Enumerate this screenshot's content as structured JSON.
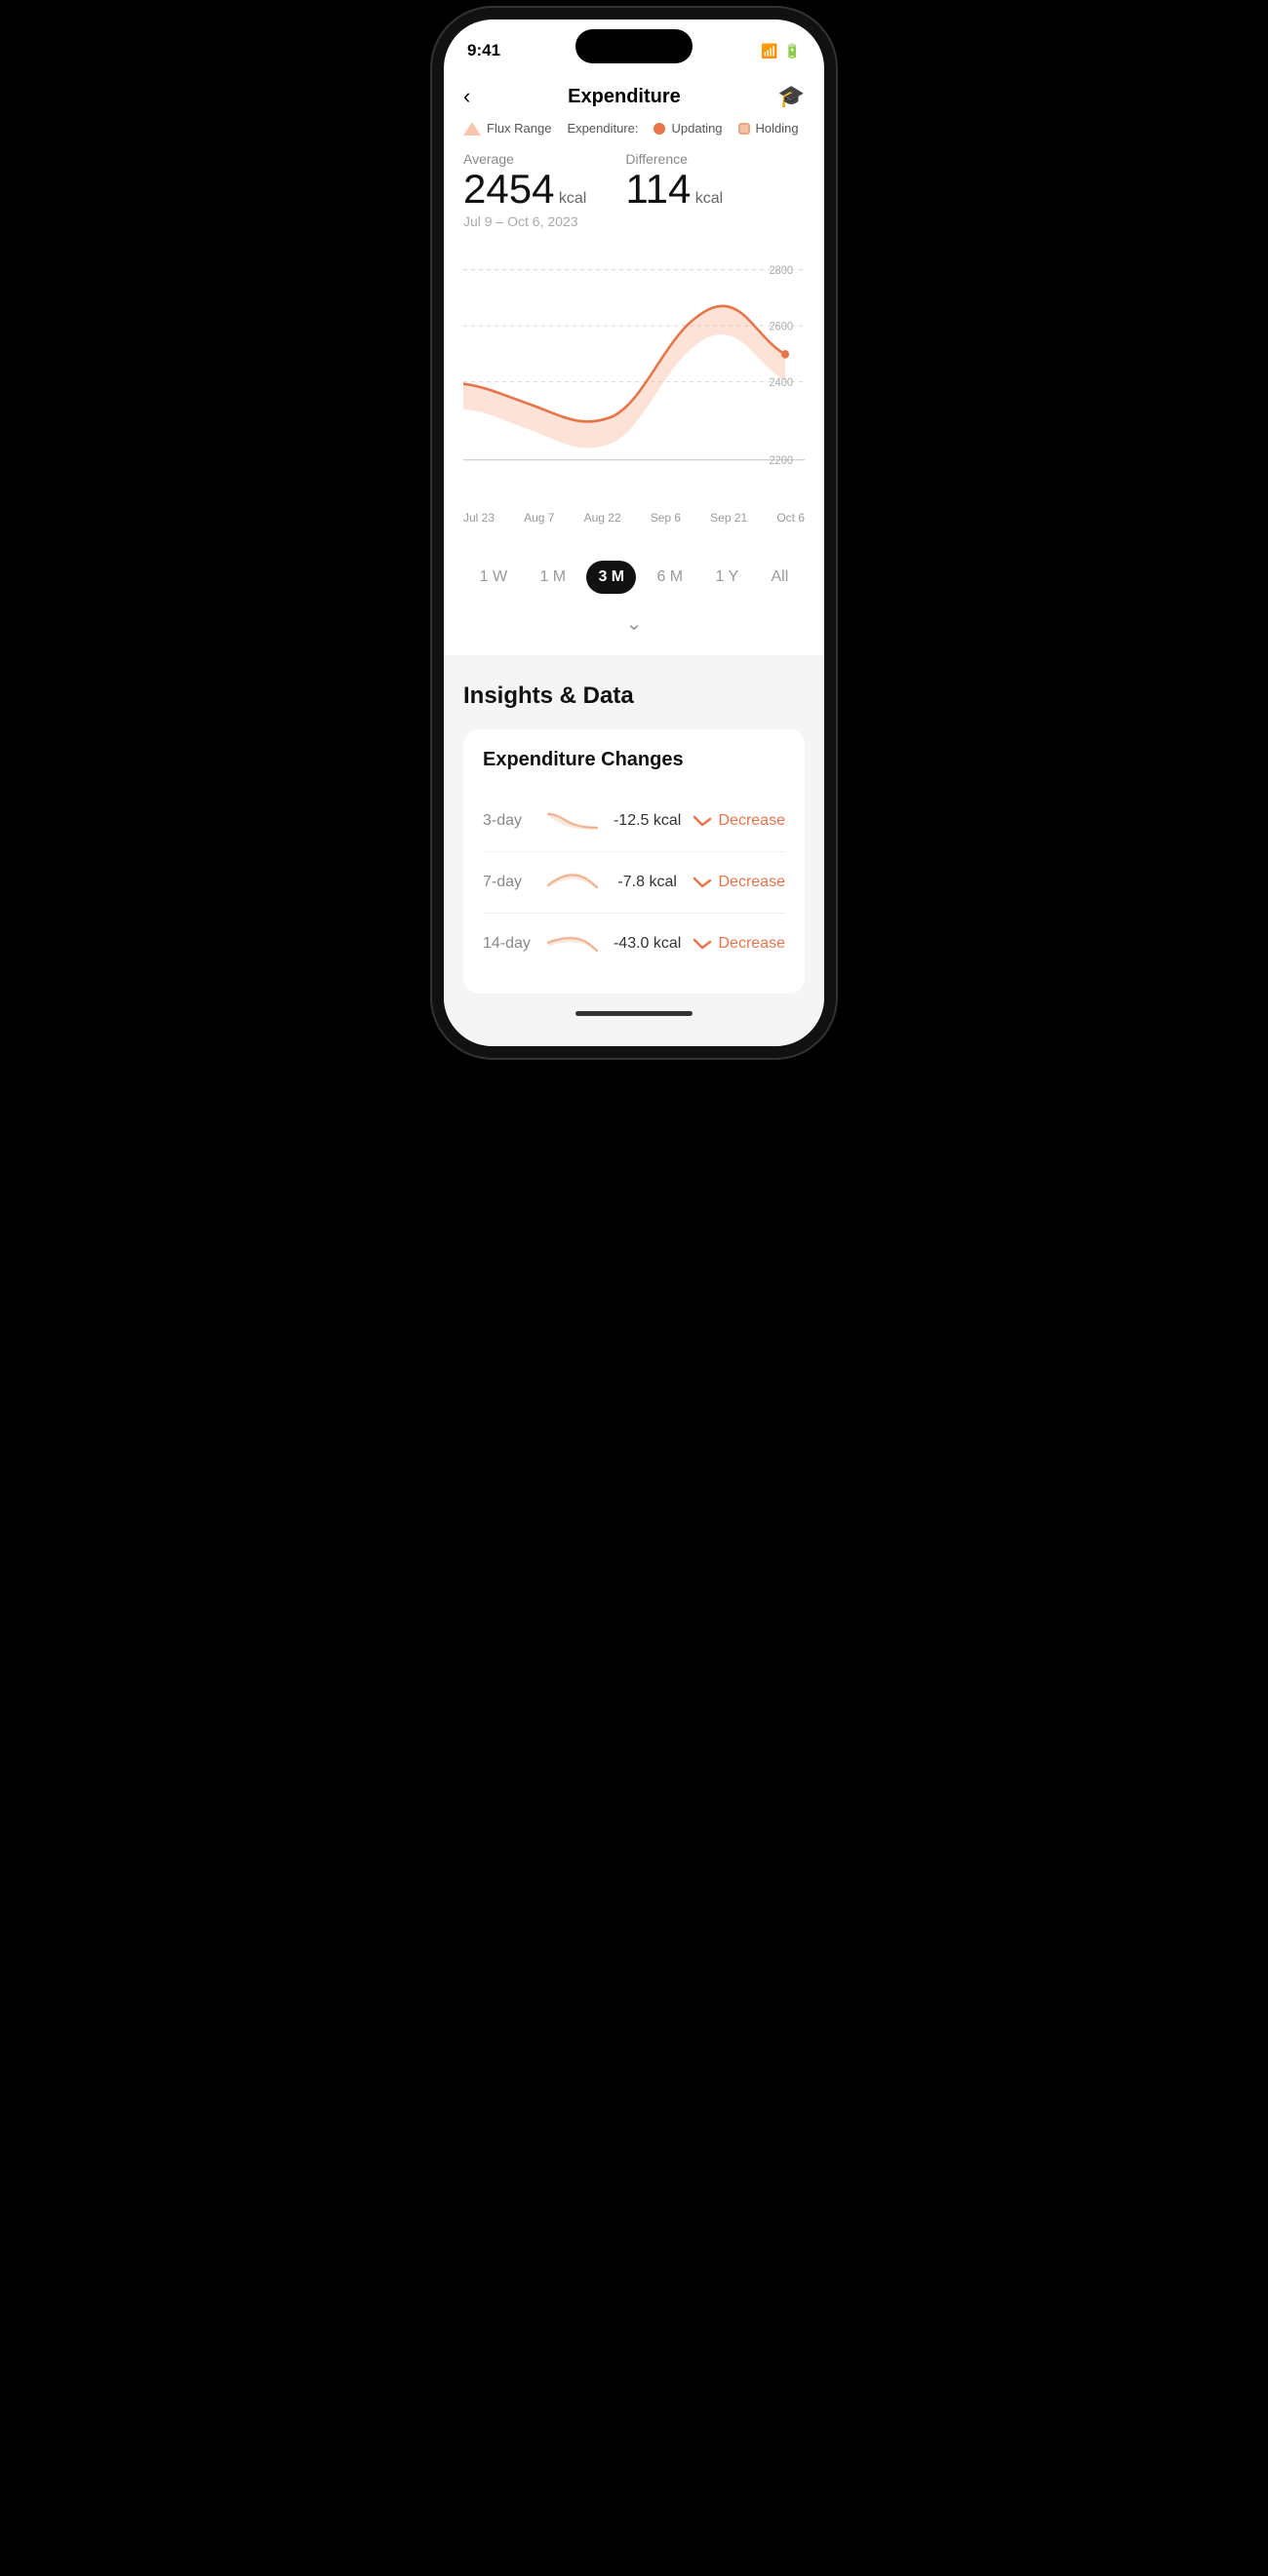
{
  "statusBar": {
    "time": "9:41"
  },
  "header": {
    "title": "Expenditure",
    "backLabel": "‹",
    "iconLabel": "🎓"
  },
  "legend": {
    "fluxLabel": "Flux Range",
    "expenditureLabel": "Expenditure:",
    "updatingLabel": "Updating",
    "holdingLabel": "Holding"
  },
  "stats": {
    "averageLabel": "Average",
    "averageValue": "2454",
    "averageUnit": "kcal",
    "dateRange": "Jul 9 – Oct 6, 2023",
    "differenceLabel": "Difference",
    "differenceValue": "114",
    "differenceUnit": "kcal"
  },
  "chart": {
    "yLabels": [
      "2800",
      "2600",
      "2400",
      "2200"
    ],
    "xLabels": [
      "Jul 23",
      "Aug 7",
      "Aug 22",
      "Sep 6",
      "Sep 21",
      "Oct 6"
    ]
  },
  "timeTabs": [
    {
      "label": "1 W",
      "id": "1w",
      "active": false
    },
    {
      "label": "1 M",
      "id": "1m",
      "active": false
    },
    {
      "label": "3 M",
      "id": "3m",
      "active": true
    },
    {
      "label": "6 M",
      "id": "6m",
      "active": false
    },
    {
      "label": "1 Y",
      "id": "1y",
      "active": false
    },
    {
      "label": "All",
      "id": "all",
      "active": false
    }
  ],
  "insights": {
    "title": "Insights & Data",
    "cardTitle": "Expenditure Changes",
    "changes": [
      {
        "period": "3-day",
        "value": "-12.5 kcal",
        "direction": "Decrease"
      },
      {
        "period": "7-day",
        "value": "-7.8 kcal",
        "direction": "Decrease"
      },
      {
        "period": "14-day",
        "value": "-43.0 kcal",
        "direction": "Decrease"
      }
    ]
  }
}
